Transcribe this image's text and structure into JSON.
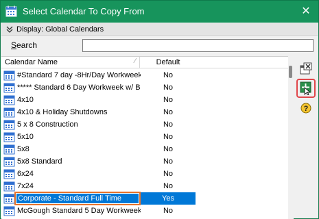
{
  "window": {
    "title": "Select Calendar To Copy From",
    "close_glyph": "✕",
    "accent": "#17945c"
  },
  "display_bar": {
    "label": "Display: Global Calendars",
    "chevron_icon": "chevron-down-icon"
  },
  "search": {
    "label_prefix": "S",
    "label_rest": "earch",
    "value": ""
  },
  "list": {
    "columns": [
      "Calendar Name",
      "Default"
    ],
    "rows": [
      {
        "name": "#Standard 7 day -8Hr/Day Workweek",
        "default": "No"
      },
      {
        "name": "***** Standard 6 Day Workweek w/ B",
        "default": "No"
      },
      {
        "name": "4x10",
        "default": "No"
      },
      {
        "name": "4x10 & Holiday Shutdowns",
        "default": "No"
      },
      {
        "name": "5 x 8 Construction",
        "default": "No"
      },
      {
        "name": "5x10",
        "default": "No"
      },
      {
        "name": "5x8",
        "default": "No"
      },
      {
        "name": "5x8 Standard",
        "default": "No"
      },
      {
        "name": "6x24",
        "default": "No"
      },
      {
        "name": "7x24",
        "default": "No"
      },
      {
        "name": "Corporate - Standard Full Time",
        "default": "Yes",
        "selected": true
      },
      {
        "name": "McGough Standard 5 Day Workweek",
        "default": "No"
      }
    ],
    "selection_color": "#0078d7",
    "focus_outline_color": "#e8732b"
  },
  "side_tools": [
    {
      "icon": "copy-calendar-icon"
    },
    {
      "icon": "copy-add-icon",
      "highlighted": true,
      "highlight_color": "#e0454a"
    },
    {
      "icon": "help-icon"
    }
  ]
}
